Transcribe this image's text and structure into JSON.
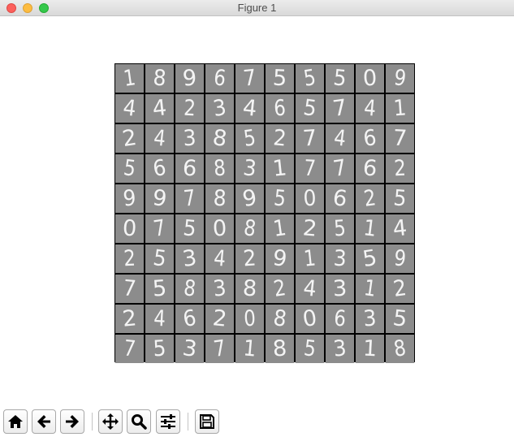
{
  "window": {
    "title": "Figure 1"
  },
  "titlebar_buttons": {
    "close": "close-icon",
    "minimize": "minimize-icon",
    "zoom": "zoom-icon"
  },
  "figure": {
    "cell_color": "#8c8c8c",
    "border_color": "#000000",
    "digit_color": "#f4f4f4",
    "digits": [
      [
        "1",
        "8",
        "9",
        "6",
        "7",
        "5",
        "5",
        "5",
        "0",
        "9"
      ],
      [
        "4",
        "4",
        "2",
        "3",
        "4",
        "6",
        "5",
        "7",
        "4",
        "1"
      ],
      [
        "2",
        "4",
        "3",
        "8",
        "5",
        "2",
        "7",
        "4",
        "6",
        "7"
      ],
      [
        "5",
        "6",
        "6",
        "8",
        "3",
        "1",
        "7",
        "7",
        "6",
        "2"
      ],
      [
        "9",
        "9",
        "7",
        "8",
        "9",
        "5",
        "0",
        "6",
        "2",
        "5"
      ],
      [
        "0",
        "7",
        "5",
        "0",
        "8",
        "1",
        "2",
        "5",
        "1",
        "4"
      ],
      [
        "2",
        "5",
        "3",
        "4",
        "2",
        "9",
        "1",
        "3",
        "5",
        "9"
      ],
      [
        "7",
        "5",
        "8",
        "3",
        "8",
        "2",
        "4",
        "3",
        "1",
        "2"
      ],
      [
        "2",
        "4",
        "6",
        "2",
        "0",
        "8",
        "0",
        "6",
        "3",
        "5"
      ],
      [
        "7",
        "5",
        "3",
        "7",
        "1",
        "8",
        "5",
        "3",
        "1",
        "8"
      ]
    ]
  },
  "toolbar": {
    "buttons": [
      {
        "name": "home-button",
        "icon": "home-icon"
      },
      {
        "name": "back-button",
        "icon": "arrow-left-icon"
      },
      {
        "name": "forward-button",
        "icon": "arrow-right-icon"
      },
      {
        "name": "pan-button",
        "icon": "move-icon"
      },
      {
        "name": "zoom-button",
        "icon": "magnifier-icon"
      },
      {
        "name": "configure-subplots-button",
        "icon": "sliders-icon"
      },
      {
        "name": "save-button",
        "icon": "floppy-disk-icon"
      }
    ]
  }
}
